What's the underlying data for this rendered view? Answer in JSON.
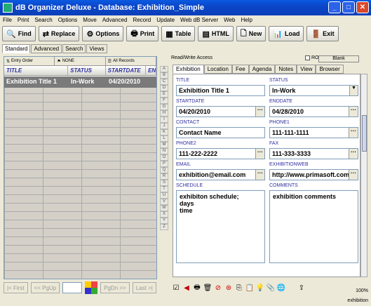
{
  "window": {
    "title": "dB Organizer Deluxe - Database: Exhibition_Simple"
  },
  "menu": [
    "File",
    "Print",
    "Search",
    "Options",
    "Move",
    "Advanced",
    "Record",
    "Update",
    "Web dB Server",
    "Web",
    "Help"
  ],
  "toolbar": {
    "find": "Find",
    "replace": "Replace",
    "options": "Options",
    "print": "Print",
    "table": "Table",
    "html": "HTML",
    "new": "New",
    "load": "Load",
    "exit": "Exit"
  },
  "view_tabs": [
    "Standard",
    "Advanced",
    "Search",
    "Views"
  ],
  "filters": {
    "order": "Entry Order",
    "none": "NONE",
    "all": "All Records"
  },
  "grid": {
    "columns": [
      "TITLE",
      "STATUS",
      "STARTDATE",
      "EN"
    ],
    "rows": [
      [
        "Exhibition Title 1",
        "In-Work",
        "04/20/2010",
        ""
      ]
    ]
  },
  "nav": {
    "first": "First",
    "pgup": "PgUp",
    "pgdn": "PgDn",
    "last": "Last"
  },
  "alphabet": [
    "A",
    "B",
    "C",
    "D",
    "E",
    "F",
    "G",
    "H",
    "I",
    "J",
    "K",
    "L",
    "M",
    "N",
    "O",
    "P",
    "Q",
    "R",
    "S",
    "T",
    "U",
    "V",
    "W",
    "X",
    "Y",
    "Z"
  ],
  "mode": "Read/Write Access",
  "ro_label": "RO",
  "blank_label": "Blank",
  "form_tabs": [
    "Exhibition",
    "Location",
    "Fee",
    "Agenda",
    "Notes",
    "View",
    "Browser"
  ],
  "fields": {
    "title": {
      "label": "TITLE",
      "value": "Exhibition Title 1"
    },
    "status": {
      "label": "STATUS",
      "value": "In-Work"
    },
    "startdate": {
      "label": "STARTDATE",
      "value": "04/20/2010"
    },
    "enddate": {
      "label": "ENDDATE",
      "value": "04/28/2010"
    },
    "contact": {
      "label": "CONTACT",
      "value": "Contact Name"
    },
    "phone1": {
      "label": "PHONE1",
      "value": "111-111-1111"
    },
    "phone2": {
      "label": "PHONE2",
      "value": "111-222-2222"
    },
    "fax": {
      "label": "FAX",
      "value": "111-333-3333"
    },
    "email": {
      "label": "EMAIL",
      "value": "exhibition@email.com"
    },
    "web": {
      "label": "EXHIBITIONWEB",
      "value": "http://www.primasoft.com"
    },
    "schedule": {
      "label": "SCHEDULE",
      "value": "exhibiton schedule;\ndays\ntime"
    },
    "comments": {
      "label": "COMMENTS",
      "value": "exhibition comments"
    }
  },
  "status": {
    "label": "exhibition",
    "zoom": "100%"
  }
}
